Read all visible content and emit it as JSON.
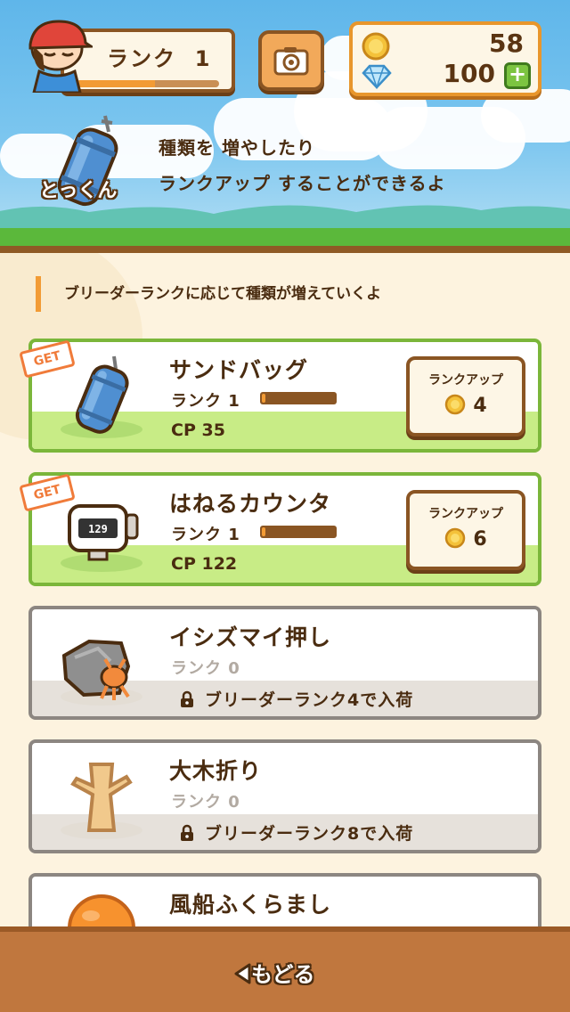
{
  "header": {
    "rank_label": "ランク",
    "rank_value": "1",
    "rank_progress": 0.55,
    "coins": "58",
    "gems": "100",
    "add_label": "+"
  },
  "intro": {
    "character_label": "とっくん",
    "line1": "種類を 増やしたり",
    "line2": "ランクアップ することができるよ"
  },
  "note": "ブリーダーランクに応じて種類が増えていくよ",
  "items": [
    {
      "name": "サンドバッグ",
      "rank": "ランク 1",
      "rank_progress": 0.05,
      "cp": "CP 35",
      "get_label": "GET",
      "rankup_label": "ランクアップ",
      "rankup_cost": "4",
      "icon": "sandbag-icon"
    },
    {
      "name": "はねるカウンタ",
      "rank": "ランク 1",
      "rank_progress": 0.05,
      "cp": "CP 122",
      "get_label": "GET",
      "rankup_label": "ランクアップ",
      "rankup_cost": "6",
      "counter_display": "129",
      "icon": "counter-icon"
    },
    {
      "name": "イシズマイ押し",
      "rank": "ランク 0",
      "unlock": "ブリーダーランク4で入荷",
      "icon": "dwebble-rock-icon"
    },
    {
      "name": "大木折り",
      "rank": "ランク 0",
      "unlock": "ブリーダーランク8で入荷",
      "icon": "tree-trunk-icon"
    },
    {
      "name": "風船ふくらまし",
      "icon": "balloon-icon"
    }
  ],
  "footer": {
    "back_label": "もどる"
  },
  "colors": {
    "brown": "#8a5523",
    "orange": "#f29b35",
    "green_border": "#7bb63a",
    "green_fill": "#c8ec86",
    "locked_border": "#8c8681"
  }
}
